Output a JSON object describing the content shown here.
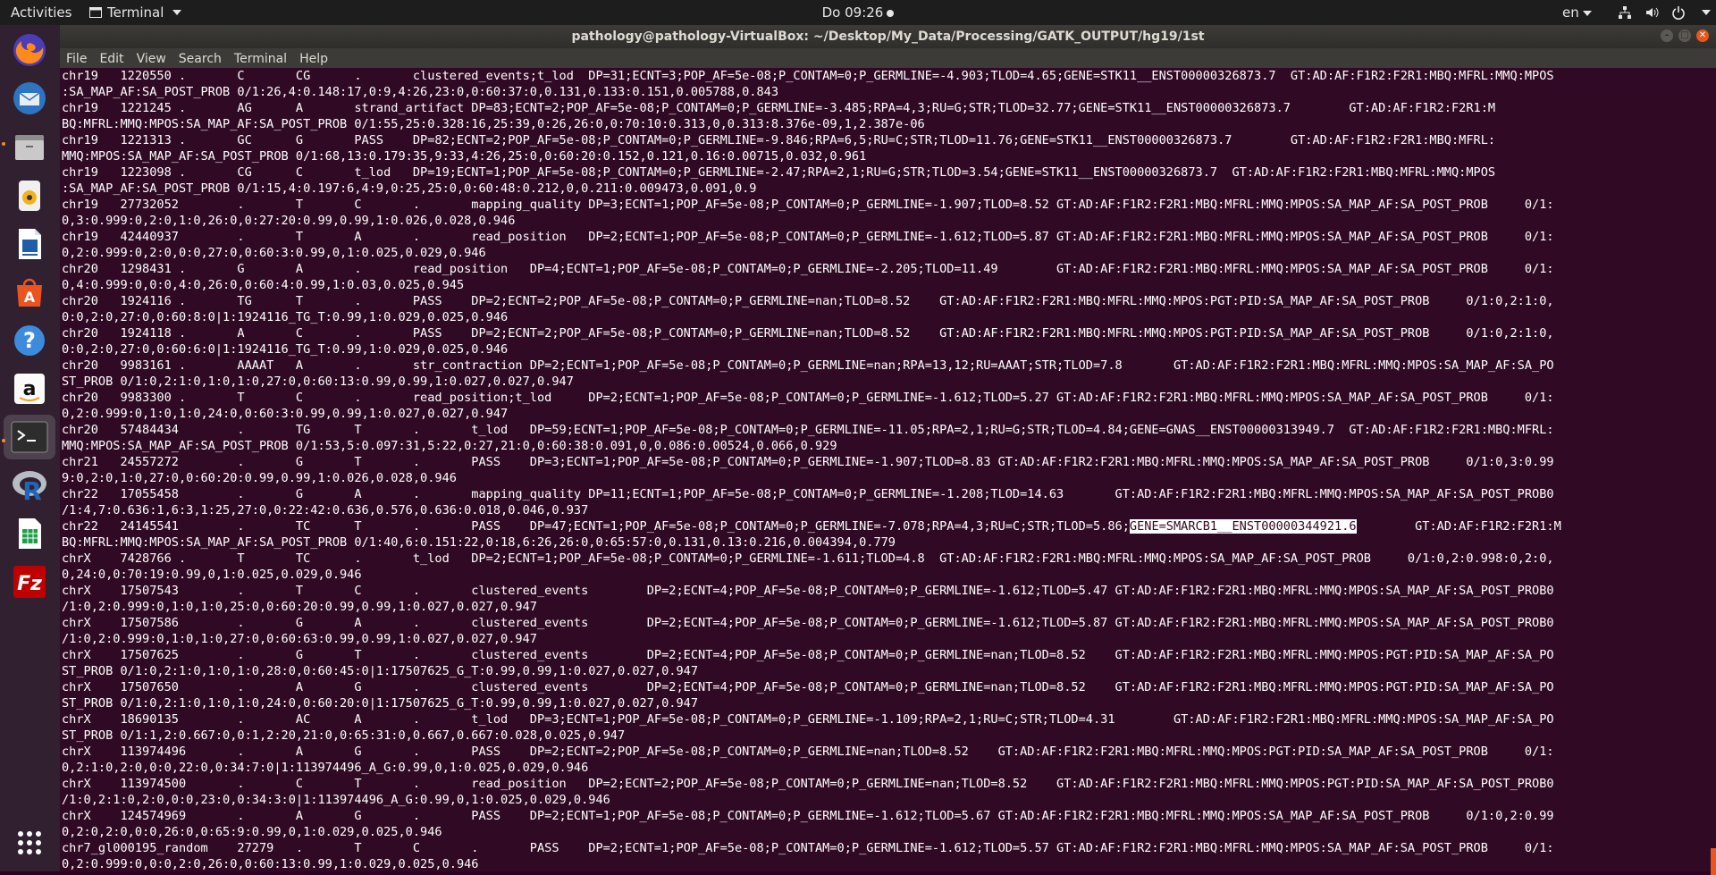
{
  "topbar": {
    "activities": "Activities",
    "app_name": "Terminal",
    "clock": "Do 09:26",
    "lang": "en"
  },
  "dock": {
    "items": [
      {
        "icon": "firefox-icon"
      },
      {
        "icon": "thunderbird-icon"
      },
      {
        "icon": "files-icon"
      },
      {
        "icon": "rhythmbox-icon"
      },
      {
        "icon": "writer-icon"
      },
      {
        "icon": "software-icon"
      },
      {
        "icon": "help-icon"
      },
      {
        "icon": "amazon-icon"
      },
      {
        "icon": "terminal-icon"
      },
      {
        "icon": "r-icon",
        "label": "R"
      },
      {
        "icon": "calc-icon"
      },
      {
        "icon": "filezilla-icon",
        "label": "Fz"
      },
      {
        "icon": "show-apps-icon"
      }
    ]
  },
  "window": {
    "title": "pathology@pathology-VirtualBox: ~/Desktop/My_Data/Processing/GATK_OUTPUT/hg19/1st",
    "menu": [
      "File",
      "Edit",
      "View",
      "Search",
      "Terminal",
      "Help"
    ]
  },
  "terminal": {
    "lines": [
      "chr19   1220550 .       C       CG      .       clustered_events;t_lod  DP=31;ECNT=3;POP_AF=5e-08;P_CONTAM=0;P_GERMLINE=-4.903;TLOD=4.65;GENE=STK11__ENST00000326873.7  GT:AD:AF:F1R2:F2R1:MBQ:MFRL:MMQ:MPOS",
      ":SA_MAP_AF:SA_POST_PROB 0/1:26,4:0.148:17,0:9,4:26,23:0,0:60:37:0,0.131,0.133:0.151,0.005788,0.843",
      "chr19   1221245 .       AG      A       strand_artifact DP=83;ECNT=2;POP_AF=5e-08;P_CONTAM=0;P_GERMLINE=-3.485;RPA=4,3;RU=G;STR;TLOD=32.77;GENE=STK11__ENST00000326873.7        GT:AD:AF:F1R2:F2R1:M",
      "BQ:MFRL:MMQ:MPOS:SA_MAP_AF:SA_POST_PROB 0/1:55,25:0.328:16,25:39,0:26,26:0,0:70:10:0.313,0,0.313:8.376e-09,1,2.387e-06",
      "chr19   1221313 .       GC      G       PASS    DP=82;ECNT=2;POP_AF=5e-08;P_CONTAM=0;P_GERMLINE=-9.846;RPA=6,5;RU=C;STR;TLOD=11.76;GENE=STK11__ENST00000326873.7        GT:AD:AF:F1R2:F2R1:MBQ:MFRL:",
      "MMQ:MPOS:SA_MAP_AF:SA_POST_PROB 0/1:68,13:0.179:35,9:33,4:26,25:0,0:60:20:0.152,0.121,0.16:0.00715,0.032,0.961",
      "chr19   1223098 .       CG      C       t_lod   DP=19;ECNT=1;POP_AF=5e-08;P_CONTAM=0;P_GERMLINE=-2.47;RPA=2,1;RU=G;STR;TLOD=3.54;GENE=STK11__ENST00000326873.7  GT:AD:AF:F1R2:F2R1:MBQ:MFRL:MMQ:MPOS",
      ":SA_MAP_AF:SA_POST_PROB 0/1:15,4:0.197:6,4:9,0:25,25:0,0:60:48:0.212,0,0.211:0.009473,0.091,0.9",
      "chr19   27732052        .       T       C       .       mapping_quality DP=3;ECNT=1;POP_AF=5e-08;P_CONTAM=0;P_GERMLINE=-1.907;TLOD=8.52 GT:AD:AF:F1R2:F2R1:MBQ:MFRL:MMQ:MPOS:SA_MAP_AF:SA_POST_PROB     0/1:",
      "0,3:0.999:0,2:0,1:0,26:0,0:27:20:0.99,0.99,1:0.026,0.028,0.946",
      "chr19   42440937        .       T       A       .       read_position   DP=2;ECNT=1;POP_AF=5e-08;P_CONTAM=0;P_GERMLINE=-1.612;TLOD=5.87 GT:AD:AF:F1R2:F2R1:MBQ:MFRL:MMQ:MPOS:SA_MAP_AF:SA_POST_PROB     0/1:",
      "0,2:0.999:0,2:0,0:0,27:0,0:60:3:0.99,0,1:0.025,0.029,0.946",
      "chr20   1298431 .       G       A       .       read_position   DP=4;ECNT=1;POP_AF=5e-08;P_CONTAM=0;P_GERMLINE=-2.205;TLOD=11.49        GT:AD:AF:F1R2:F2R1:MBQ:MFRL:MMQ:MPOS:SA_MAP_AF:SA_POST_PROB     0/1:",
      "0,4:0.999:0,0:0,4:0,26:0,0:60:4:0.99,1:0.03,0.025,0.945",
      "chr20   1924116 .       TG      T       .       PASS    DP=2;ECNT=2;POP_AF=5e-08;P_CONTAM=0;P_GERMLINE=nan;TLOD=8.52    GT:AD:AF:F1R2:F2R1:MBQ:MFRL:MMQ:MPOS:PGT:PID:SA_MAP_AF:SA_POST_PROB     0/1:0,2:1:0,",
      "0:0,2:0,27:0,0:60:8:0|1:1924116_TG_T:0.99,1:0.029,0.025,0.946",
      "chr20   1924118 .       A       C       .       PASS    DP=2;ECNT=2;POP_AF=5e-08;P_CONTAM=0;P_GERMLINE=nan;TLOD=8.52    GT:AD:AF:F1R2:F2R1:MBQ:MFRL:MMQ:MPOS:PGT:PID:SA_MAP_AF:SA_POST_PROB     0/1:0,2:1:0,",
      "0:0,2:0,27:0,0:60:6:0|1:1924116_TG_T:0.99,1:0.029,0.025,0.946",
      "chr20   9983161 .       AAAAT   A       .       str_contraction DP=2;ECNT=1;POP_AF=5e-08;P_CONTAM=0;P_GERMLINE=nan;RPA=13,12;RU=AAAT;STR;TLOD=7.8       GT:AD:AF:F1R2:F2R1:MBQ:MFRL:MMQ:MPOS:SA_MAP_AF:SA_PO",
      "ST_PROB 0/1:0,2:1:0,1:0,1:0,27:0,0:60:13:0.99,0.99,1:0.027,0.027,0.947",
      "chr20   9983300 .       T       C       .       read_position;t_lod     DP=2;ECNT=1;POP_AF=5e-08;P_CONTAM=0;P_GERMLINE=-1.612;TLOD=5.27 GT:AD:AF:F1R2:F2R1:MBQ:MFRL:MMQ:MPOS:SA_MAP_AF:SA_POST_PROB     0/1:",
      "0,2:0.999:0,1:0,1:0,24:0,0:60:3:0.99,0.99,1:0.027,0.027,0.947",
      "chr20   57484434        .       TG      T       .       t_lod   DP=59;ECNT=1;POP_AF=5e-08;P_CONTAM=0;P_GERMLINE=-11.05;RPA=2,1;RU=G;STR;TLOD=4.84;GENE=GNAS__ENST00000313949.7  GT:AD:AF:F1R2:F2R1:MBQ:MFRL:",
      "MMQ:MPOS:SA_MAP_AF:SA_POST_PROB 0/1:53,5:0.097:31,5:22,0:27,21:0,0:60:38:0.091,0,0.086:0.00524,0.066,0.929",
      "chr21   24557272        .       G       T       .       PASS    DP=3;ECNT=1;POP_AF=5e-08;P_CONTAM=0;P_GERMLINE=-1.907;TLOD=8.83 GT:AD:AF:F1R2:F2R1:MBQ:MFRL:MMQ:MPOS:SA_MAP_AF:SA_POST_PROB     0/1:0,3:0.99",
      "9:0,2:0,1:0,27:0,0:60:20:0.99,0.99,1:0.026,0.028,0.946",
      "chr22   17055458        .       G       A       .       mapping_quality DP=11;ECNT=1;POP_AF=5e-08;P_CONTAM=0;P_GERMLINE=-1.208;TLOD=14.63       GT:AD:AF:F1R2:F2R1:MBQ:MFRL:MMQ:MPOS:SA_MAP_AF:SA_POST_PROB0",
      "/1:4,7:0.636:1,6:3,1:25,27:0,0:22:42:0.636,0.576,0.636:0.018,0.046,0.937",
      "chr22   24145541        .       TC      T       .       PASS    DP=47;ECNT=1;POP_AF=5e-08;P_CONTAM=0;P_GERMLINE=-7.078;RPA=4,3;RU=C;STR;TLOD=5.86;",
      "BQ:MFRL:MMQ:MPOS:SA_MAP_AF:SA_POST_PROB 0/1:40,6:0.151:22,0:18,6:26,26:0,0:65:57:0,0.131,0.13:0.216,0.004394,0.779",
      "chrX    7428766 .       T       TC      .       t_lod   DP=2;ECNT=1;POP_AF=5e-08;P_CONTAM=0;P_GERMLINE=-1.611;TLOD=4.8  GT:AD:AF:F1R2:F2R1:MBQ:MFRL:MMQ:MPOS:SA_MAP_AF:SA_POST_PROB     0/1:0,2:0.998:0,2:0,",
      "0,24:0,0:70:19:0.99,0,1:0.025,0.029,0.946",
      "chrX    17507543        .       T       C       .       clustered_events        DP=2;ECNT=4;POP_AF=5e-08;P_CONTAM=0;P_GERMLINE=-1.612;TLOD=5.47 GT:AD:AF:F1R2:F2R1:MBQ:MFRL:MMQ:MPOS:SA_MAP_AF:SA_POST_PROB0",
      "/1:0,2:0.999:0,1:0,1:0,25:0,0:60:20:0.99,0.99,1:0.027,0.027,0.947",
      "chrX    17507586        .       G       A       .       clustered_events        DP=2;ECNT=4;POP_AF=5e-08;P_CONTAM=0;P_GERMLINE=-1.612;TLOD=5.87 GT:AD:AF:F1R2:F2R1:MBQ:MFRL:MMQ:MPOS:SA_MAP_AF:SA_POST_PROB0",
      "/1:0,2:0.999:0,1:0,1:0,27:0,0:60:63:0.99,0.99,1:0.027,0.027,0.947",
      "chrX    17507625        .       G       T       .       clustered_events        DP=2;ECNT=4;POP_AF=5e-08;P_CONTAM=0;P_GERMLINE=nan;TLOD=8.52    GT:AD:AF:F1R2:F2R1:MBQ:MFRL:MMQ:MPOS:PGT:PID:SA_MAP_AF:SA_PO",
      "ST_PROB 0/1:0,2:1:0,1:0,1:0,28:0,0:60:45:0|1:17507625_G_T:0.99,0.99,1:0.027,0.027,0.947",
      "chrX    17507650        .       A       G       .       clustered_events        DP=2;ECNT=4;POP_AF=5e-08;P_CONTAM=0;P_GERMLINE=nan;TLOD=8.52    GT:AD:AF:F1R2:F2R1:MBQ:MFRL:MMQ:MPOS:PGT:PID:SA_MAP_AF:SA_PO",
      "ST_PROB 0/1:0,2:1:0,1:0,1:0,24:0,0:60:20:0|1:17507625_G_T:0.99,0.99,1:0.027,0.027,0.947",
      "chrX    18690135        .       AC      A       .       t_lod   DP=3;ECNT=1;POP_AF=5e-08;P_CONTAM=0;P_GERMLINE=-1.109;RPA=2,1;RU=C;STR;TLOD=4.31        GT:AD:AF:F1R2:F2R1:MBQ:MFRL:MMQ:MPOS:SA_MAP_AF:SA_PO",
      "ST_PROB 0/1:1,2:0.667:0,0:1,2:20,21:0,0:65:31:0,0.667,0.667:0.028,0.025,0.947",
      "chrX    113974496       .       A       G       .       PASS    DP=2;ECNT=2;POP_AF=5e-08;P_CONTAM=0;P_GERMLINE=nan;TLOD=8.52    GT:AD:AF:F1R2:F2R1:MBQ:MFRL:MMQ:MPOS:PGT:PID:SA_MAP_AF:SA_POST_PROB     0/1:",
      "0,2:1:0,2:0,0:0,22:0,0:34:7:0|1:113974496_A_G:0.99,0,1:0.025,0.029,0.946",
      "chrX    113974500       .       C       T       .       read_position   DP=2;ECNT=2;POP_AF=5e-08;P_CONTAM=0;P_GERMLINE=nan;TLOD=8.52    GT:AD:AF:F1R2:F2R1:MBQ:MFRL:MMQ:MPOS:PGT:PID:SA_MAP_AF:SA_POST_PROB0",
      "/1:0,2:1:0,2:0,0:0,23:0,0:34:3:0|1:113974496_A_G:0.99,0,1:0.025,0.029,0.946",
      "chrX    124574969       .       A       G       .       PASS    DP=2;ECNT=1;POP_AF=5e-08;P_CONTAM=0;P_GERMLINE=-1.612;TLOD=5.67 GT:AD:AF:F1R2:F2R1:MBQ:MFRL:MMQ:MPOS:SA_MAP_AF:SA_POST_PROB     0/1:0,2:0.99",
      "0,2:0,2:0,0:0,26:0,0:65:9:0.99,0,1:0.029,0.025,0.946",
      "chr7_gl000195_random    27279   .       T       C       .       PASS    DP=2;ECNT=1;POP_AF=5e-08;P_CONTAM=0;P_GERMLINE=-1.612;TLOD=5.57 GT:AD:AF:F1R2:F2R1:MBQ:MFRL:MMQ:MPOS:SA_MAP_AF:SA_POST_PROB     0/1:",
      "0,2:0.999:0,0:0,2:0,26:0,0:60:13:0.99,1:0.029,0.025,0.946"
    ],
    "selected_text": "GENE=SMARCB1__ENST00000344921.6",
    "selected_line_tail": "        GT:AD:AF:F1R2:F2R1:M"
  }
}
